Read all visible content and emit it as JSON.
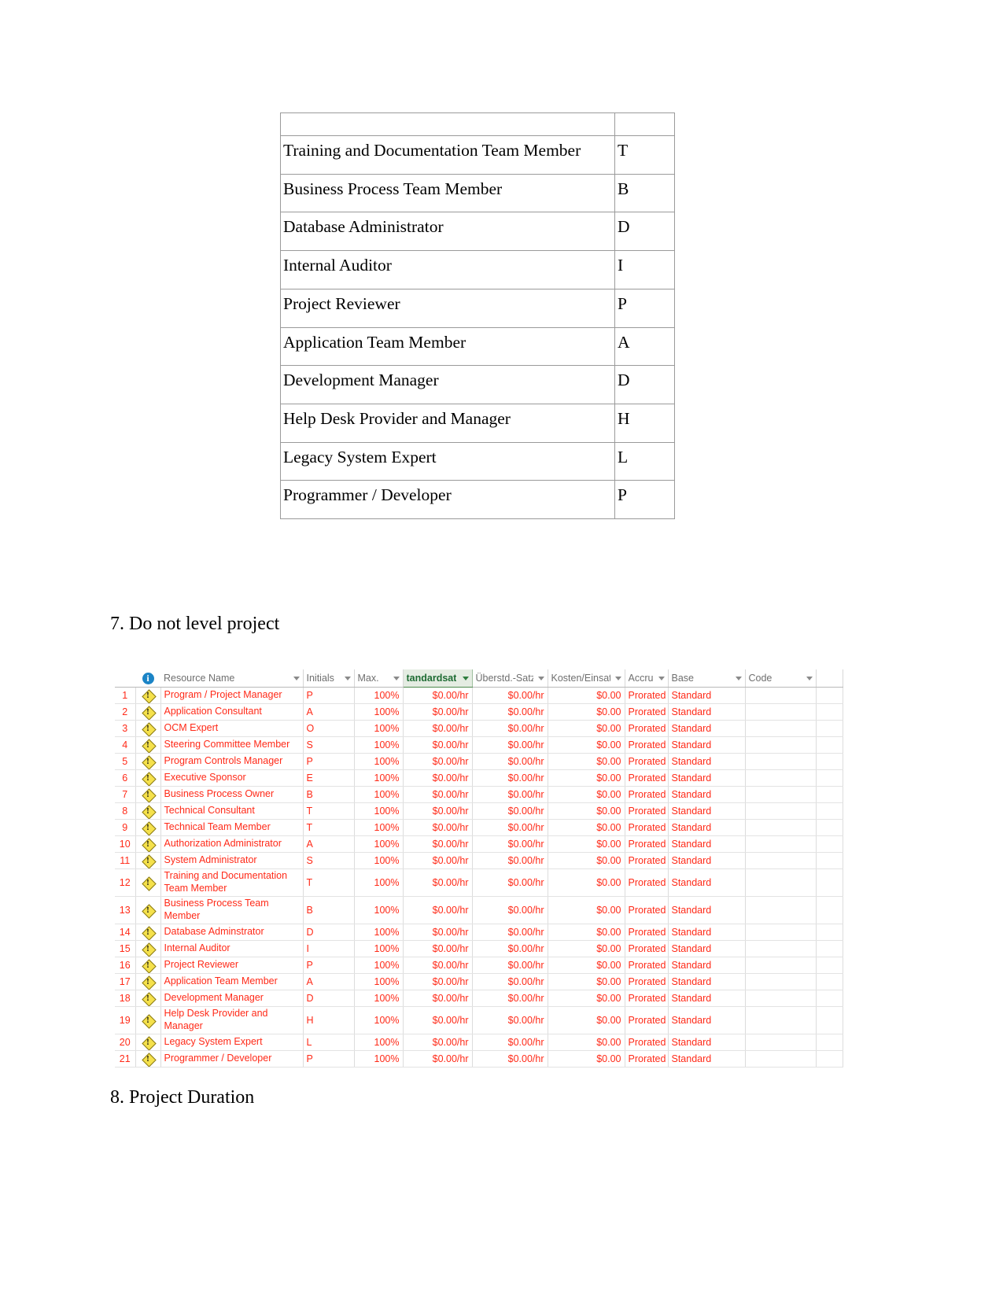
{
  "document": {
    "roles_table": {
      "has_empty_first_row": true,
      "rows": [
        {
          "role": "Training and Documentation Team Member",
          "initial": "T"
        },
        {
          "role": "Business Process Team Member",
          "initial": "B"
        },
        {
          "role": "Database Administrator",
          "initial": "D"
        },
        {
          "role": "Internal Auditor",
          "initial": "I"
        },
        {
          "role": "Project Reviewer",
          "initial": "P"
        },
        {
          "role": "Application Team Member",
          "initial": "A"
        },
        {
          "role": "Development Manager",
          "initial": "D"
        },
        {
          "role": "Help Desk Provider and Manager",
          "initial": "H"
        },
        {
          "role": "Legacy System Expert",
          "initial": "L"
        },
        {
          "role": "Programmer / Developer",
          "initial": "P"
        }
      ]
    },
    "heading_7": "7. Do not level project",
    "heading_8": "8. Project Duration"
  },
  "spreadsheet": {
    "columns": [
      {
        "key": "rownum",
        "label": ""
      },
      {
        "key": "indicator",
        "label": "",
        "icon": "info-icon"
      },
      {
        "key": "resource_name",
        "label": "Resource Name",
        "has_filter": true
      },
      {
        "key": "initials",
        "label": "Initials",
        "has_filter": true
      },
      {
        "key": "max",
        "label": "Max.",
        "has_filter": true
      },
      {
        "key": "standard_rate",
        "label": "tandardsat",
        "has_filter": true,
        "highlighted": true
      },
      {
        "key": "overtime_rate",
        "label": "Überstd.-Satz",
        "has_filter": true
      },
      {
        "key": "cost_per_use",
        "label": "Kosten/Einsatz",
        "has_filter": true
      },
      {
        "key": "accrue_at",
        "label": "Accrue",
        "has_filter": true
      },
      {
        "key": "base_calendar",
        "label": "Base",
        "has_filter": true
      },
      {
        "key": "code",
        "label": "Code",
        "has_filter": true
      }
    ],
    "colors": {
      "cell_text_red": "#ff2a18",
      "header_text_gray": "#6f6f6f",
      "highlight_green_bg": "#e4ece2",
      "highlight_green_text": "#1e6b33",
      "info_icon_blue": "#1b84c6",
      "warning_icon_yellow": "#f5e14b"
    },
    "rows": [
      {
        "n": "1",
        "icon": "warning-icon",
        "name": "Program / Project Manager",
        "bold": true,
        "initials": "P",
        "max": "100%",
        "standard_rate": "$0.00/hr",
        "overtime_rate": "$0.00/hr",
        "cost_per_use": "$0.00",
        "accrue_at": "Prorated",
        "base_calendar": "Standard",
        "code": ""
      },
      {
        "n": "2",
        "icon": "warning-icon",
        "name": "Application Consultant",
        "bold": true,
        "initials": "A",
        "max": "100%",
        "standard_rate": "$0.00/hr",
        "overtime_rate": "$0.00/hr",
        "cost_per_use": "$0.00",
        "accrue_at": "Prorated",
        "base_calendar": "Standard",
        "code": ""
      },
      {
        "n": "3",
        "icon": "warning-icon",
        "name": "OCM Expert",
        "bold": true,
        "initials": "O",
        "max": "100%",
        "standard_rate": "$0.00/hr",
        "overtime_rate": "$0.00/hr",
        "cost_per_use": "$0.00",
        "accrue_at": "Prorated",
        "base_calendar": "Standard",
        "code": ""
      },
      {
        "n": "4",
        "icon": "warning-icon",
        "name": "Steering Committee Member",
        "bold": true,
        "initials": "S",
        "max": "100%",
        "standard_rate": "$0.00/hr",
        "overtime_rate": "$0.00/hr",
        "cost_per_use": "$0.00",
        "accrue_at": "Prorated",
        "base_calendar": "Standard",
        "code": ""
      },
      {
        "n": "5",
        "icon": "warning-icon",
        "name": "Program Controls Manager",
        "bold": true,
        "initials": "P",
        "max": "100%",
        "standard_rate": "$0.00/hr",
        "overtime_rate": "$0.00/hr",
        "cost_per_use": "$0.00",
        "accrue_at": "Prorated",
        "base_calendar": "Standard",
        "code": ""
      },
      {
        "n": "6",
        "icon": "warning-icon",
        "name": "Executive Sponsor",
        "bold": true,
        "initials": "E",
        "max": "100%",
        "standard_rate": "$0.00/hr",
        "overtime_rate": "$0.00/hr",
        "cost_per_use": "$0.00",
        "accrue_at": "Prorated",
        "base_calendar": "Standard",
        "code": ""
      },
      {
        "n": "7",
        "icon": "warning-icon",
        "name": "Business Process Owner",
        "bold": true,
        "initials": "B",
        "max": "100%",
        "standard_rate": "$0.00/hr",
        "overtime_rate": "$0.00/hr",
        "cost_per_use": "$0.00",
        "accrue_at": "Prorated",
        "base_calendar": "Standard",
        "code": ""
      },
      {
        "n": "8",
        "icon": "warning-icon",
        "name": "Technical Consultant",
        "bold": true,
        "initials": "T",
        "max": "100%",
        "standard_rate": "$0.00/hr",
        "overtime_rate": "$0.00/hr",
        "cost_per_use": "$0.00",
        "accrue_at": "Prorated",
        "base_calendar": "Standard",
        "code": ""
      },
      {
        "n": "9",
        "icon": "warning-icon",
        "name": "Technical Team Member",
        "bold": true,
        "initials": "T",
        "max": "100%",
        "standard_rate": "$0.00/hr",
        "overtime_rate": "$0.00/hr",
        "cost_per_use": "$0.00",
        "accrue_at": "Prorated",
        "base_calendar": "Standard",
        "code": ""
      },
      {
        "n": "10",
        "icon": "warning-icon",
        "name": "Authorization Administrator",
        "bold": true,
        "initials": "A",
        "max": "100%",
        "standard_rate": "$0.00/hr",
        "overtime_rate": "$0.00/hr",
        "cost_per_use": "$0.00",
        "accrue_at": "Prorated",
        "base_calendar": "Standard",
        "code": ""
      },
      {
        "n": "11",
        "icon": "warning-icon",
        "name": "System Administrator",
        "bold": true,
        "initials": "S",
        "max": "100%",
        "standard_rate": "$0.00/hr",
        "overtime_rate": "$0.00/hr",
        "cost_per_use": "$0.00",
        "accrue_at": "Prorated",
        "base_calendar": "Standard",
        "code": ""
      },
      {
        "n": "12",
        "icon": "warning-icon",
        "name": "Training and Documentation Team Member",
        "bold": true,
        "tall": true,
        "initials": "T",
        "max": "100%",
        "standard_rate": "$0.00/hr",
        "overtime_rate": "$0.00/hr",
        "cost_per_use": "$0.00",
        "accrue_at": "Prorated",
        "base_calendar": "Standard",
        "code": ""
      },
      {
        "n": "13",
        "icon": "warning-icon",
        "name": "Business Process Team Member",
        "bold": true,
        "tall": true,
        "initials": "B",
        "max": "100%",
        "standard_rate": "$0.00/hr",
        "overtime_rate": "$0.00/hr",
        "cost_per_use": "$0.00",
        "accrue_at": "Prorated",
        "base_calendar": "Standard",
        "code": ""
      },
      {
        "n": "14",
        "icon": "warning-icon",
        "name": "Database Adminstrator",
        "bold": false,
        "initials": "D",
        "max": "100%",
        "standard_rate": "$0.00/hr",
        "overtime_rate": "$0.00/hr",
        "cost_per_use": "$0.00",
        "accrue_at": "Prorated",
        "base_calendar": "Standard",
        "code": ""
      },
      {
        "n": "15",
        "icon": "warning-icon",
        "name": "Internal Auditor",
        "bold": true,
        "initials": "I",
        "max": "100%",
        "standard_rate": "$0.00/hr",
        "overtime_rate": "$0.00/hr",
        "cost_per_use": "$0.00",
        "accrue_at": "Prorated",
        "base_calendar": "Standard",
        "code": ""
      },
      {
        "n": "16",
        "icon": "warning-icon",
        "name": "Project Reviewer",
        "bold": true,
        "initials": "P",
        "max": "100%",
        "standard_rate": "$0.00/hr",
        "overtime_rate": "$0.00/hr",
        "cost_per_use": "$0.00",
        "accrue_at": "Prorated",
        "base_calendar": "Standard",
        "code": ""
      },
      {
        "n": "17",
        "icon": "warning-icon",
        "name": "Application Team Member",
        "bold": true,
        "initials": "A",
        "max": "100%",
        "standard_rate": "$0.00/hr",
        "overtime_rate": "$0.00/hr",
        "cost_per_use": "$0.00",
        "accrue_at": "Prorated",
        "base_calendar": "Standard",
        "code": ""
      },
      {
        "n": "18",
        "icon": "warning-icon",
        "name": "Development Manager",
        "bold": true,
        "initials": "D",
        "max": "100%",
        "standard_rate": "$0.00/hr",
        "overtime_rate": "$0.00/hr",
        "cost_per_use": "$0.00",
        "accrue_at": "Prorated",
        "base_calendar": "Standard",
        "code": ""
      },
      {
        "n": "19",
        "icon": "warning-icon",
        "name": "Help Desk Provider and Manager",
        "bold": true,
        "tall": true,
        "initials": "H",
        "max": "100%",
        "standard_rate": "$0.00/hr",
        "overtime_rate": "$0.00/hr",
        "cost_per_use": "$0.00",
        "accrue_at": "Prorated",
        "base_calendar": "Standard",
        "code": ""
      },
      {
        "n": "20",
        "icon": "warning-icon",
        "name": "Legacy System Expert",
        "bold": true,
        "initials": "L",
        "max": "100%",
        "standard_rate": "$0.00/hr",
        "overtime_rate": "$0.00/hr",
        "cost_per_use": "$0.00",
        "accrue_at": "Prorated",
        "base_calendar": "Standard",
        "code": ""
      },
      {
        "n": "21",
        "icon": "warning-icon",
        "name": "Programmer / Developer",
        "bold": true,
        "initials": "P",
        "max": "100%",
        "standard_rate": "$0.00/hr",
        "overtime_rate": "$0.00/hr",
        "cost_per_use": "$0.00",
        "accrue_at": "Prorated",
        "base_calendar": "Standard",
        "code": ""
      }
    ]
  }
}
